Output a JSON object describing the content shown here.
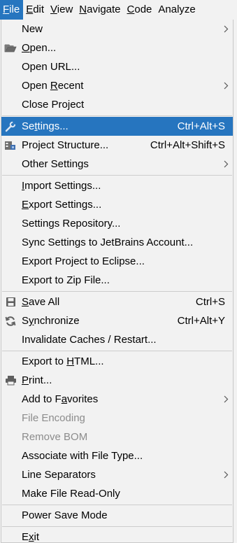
{
  "menubar": {
    "items": [
      {
        "pre": "",
        "mn": "F",
        "post": "ile",
        "name": "file"
      },
      {
        "pre": "",
        "mn": "E",
        "post": "dit",
        "name": "edit"
      },
      {
        "pre": "",
        "mn": "V",
        "post": "iew",
        "name": "view"
      },
      {
        "pre": "",
        "mn": "N",
        "post": "avigate",
        "name": "navigate"
      },
      {
        "pre": "",
        "mn": "C",
        "post": "ode",
        "name": "code"
      },
      {
        "pre": "Analyze",
        "mn": "",
        "post": "",
        "name": "analyze"
      }
    ]
  },
  "file_menu": {
    "new": {
      "pre": "New",
      "mn": "",
      "post": ""
    },
    "open": {
      "pre": "",
      "mn": "O",
      "post": "pen..."
    },
    "open_url": {
      "pre": "Open URL...",
      "mn": "",
      "post": ""
    },
    "open_recent": {
      "pre": "Open ",
      "mn": "R",
      "post": "ecent"
    },
    "close_project": {
      "pre": "Close Project",
      "mn": "",
      "post": ""
    },
    "settings": {
      "pre": "Se",
      "mn": "t",
      "post": "tings...",
      "shortcut": "Ctrl+Alt+S"
    },
    "project_structure": {
      "pre": "Project Structure...",
      "mn": "",
      "post": "",
      "shortcut": "Ctrl+Alt+Shift+S"
    },
    "other_settings": {
      "pre": "Other Settings",
      "mn": "",
      "post": ""
    },
    "import_settings": {
      "pre": "",
      "mn": "I",
      "post": "mport Settings..."
    },
    "export_settings": {
      "pre": "",
      "mn": "E",
      "post": "xport Settings..."
    },
    "settings_repository": {
      "pre": "Settings Repository...",
      "mn": "",
      "post": ""
    },
    "sync_settings": {
      "pre": "Sync Settings to JetBrains Account...",
      "mn": "",
      "post": ""
    },
    "export_eclipse": {
      "pre": "Export Project to Eclipse...",
      "mn": "",
      "post": ""
    },
    "export_zip": {
      "pre": "Export to Zip File...",
      "mn": "",
      "post": ""
    },
    "save_all": {
      "pre": "",
      "mn": "S",
      "post": "ave All",
      "shortcut": "Ctrl+S"
    },
    "synchronize": {
      "pre": "S",
      "mn": "y",
      "post": "nchronize",
      "shortcut": "Ctrl+Alt+Y"
    },
    "invalidate_caches": {
      "pre": "Invalidate Caches / Restart...",
      "mn": "",
      "post": ""
    },
    "export_html": {
      "pre": "Export to ",
      "mn": "H",
      "post": "TML..."
    },
    "print": {
      "pre": "",
      "mn": "P",
      "post": "rint..."
    },
    "add_favorites": {
      "pre": "Add to F",
      "mn": "a",
      "post": "vorites"
    },
    "file_encoding": {
      "pre": "File Encoding",
      "mn": "",
      "post": ""
    },
    "remove_bom": {
      "pre": "Remove BOM",
      "mn": "",
      "post": ""
    },
    "associate_file_type": {
      "pre": "Associate with File Type...",
      "mn": "",
      "post": ""
    },
    "line_separators": {
      "pre": "Line Separators",
      "mn": "",
      "post": ""
    },
    "make_readonly": {
      "pre": "Make File Read-Only",
      "mn": "",
      "post": ""
    },
    "power_save": {
      "pre": "Power Save Mode",
      "mn": "",
      "post": ""
    },
    "exit": {
      "pre": "E",
      "mn": "x",
      "post": "it"
    }
  },
  "colors": {
    "selection": "#2675bf",
    "menu_bg": "#f2f2f2",
    "disabled_text": "#8c8c8c",
    "separator": "#cdcdcd"
  },
  "icons": {
    "open": "folder-open-icon",
    "settings": "wrench-icon",
    "project_structure": "project-structure-icon",
    "save_all": "floppy-disk-icon",
    "synchronize": "refresh-icon",
    "print": "printer-icon",
    "submenu": "chevron-right-icon"
  }
}
